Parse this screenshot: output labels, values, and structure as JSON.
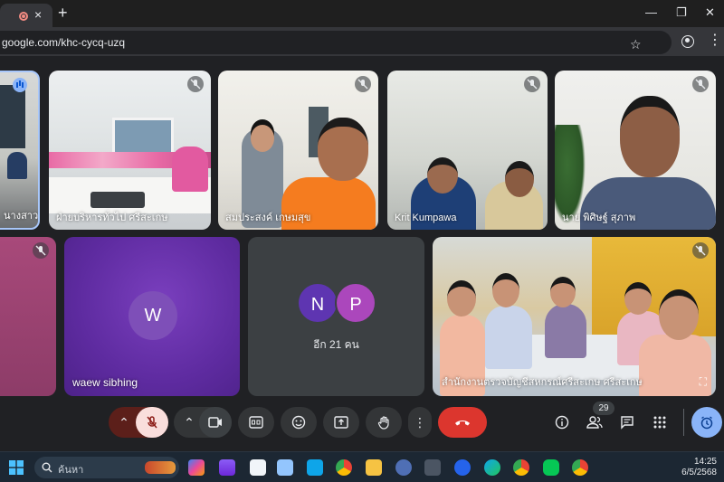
{
  "browser": {
    "tab": {
      "close_glyph": "×"
    },
    "new_tab_glyph": "+",
    "window_controls": [
      "—",
      "❐",
      "✕"
    ],
    "url": "google.com/khc-cycq-uzq"
  },
  "meet": {
    "tiles": [
      {
        "name": "นางสาว...ปศุ...",
        "muted": false,
        "speaking": true
      },
      {
        "name": "ฝ่ายบริหารทั่วไป ศรีสะเกษ",
        "muted": true
      },
      {
        "name": "สมประสงค์ เกษมสุข",
        "muted": true
      },
      {
        "name": "Krit Kumpawa",
        "muted": true
      },
      {
        "name": "นาย พิศิษฐ์ สุภาพ",
        "muted": true
      },
      {
        "name": "",
        "muted": true
      },
      {
        "name": "waew sibhing",
        "initial": "W",
        "muted": false
      },
      {
        "name": "",
        "muted": false
      },
      {
        "name": "สำนักงานตรวจบัญชีสหกรณ์ศรีสะเกษ ศรีสะเกษ",
        "muted": true
      }
    ],
    "others": {
      "initials": [
        "N",
        "P"
      ],
      "label": "อีก 21 คน"
    },
    "participants_count": "29"
  },
  "controls": {
    "colors": {
      "mic_off_bg": "#f9dedc",
      "mic_group_bg": "#5c1f1a",
      "end_call": "#dc362e",
      "activities": "#8ab4f8"
    }
  },
  "taskbar": {
    "search_placeholder": "ค้นหา",
    "time": "14:25",
    "date": "6/5/2568"
  }
}
